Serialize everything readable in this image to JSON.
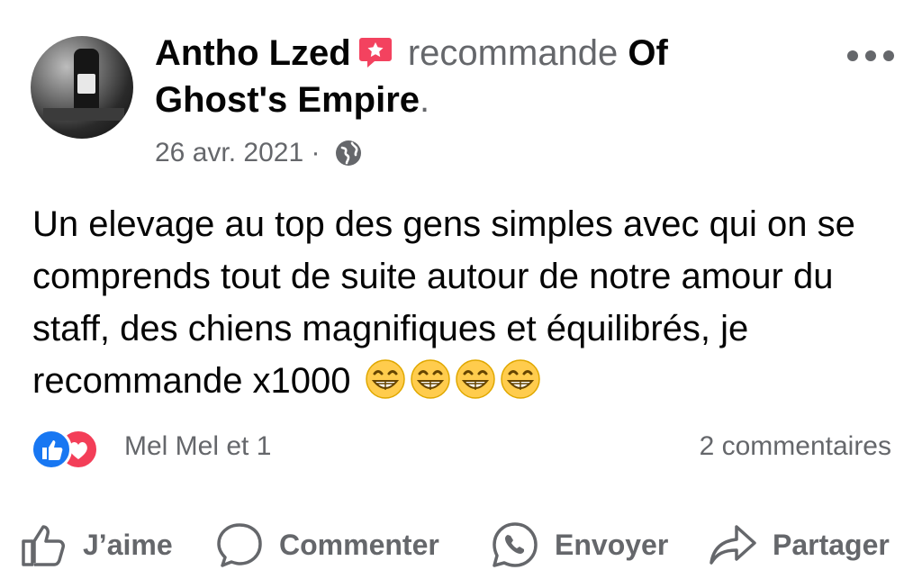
{
  "post": {
    "author": "Antho Lzed",
    "verb": "recommande",
    "page_name_line1": "Of",
    "page_name_line2": "Ghost's Empire",
    "period": ".",
    "date": "26 avr. 2021",
    "separator": "·",
    "privacy_icon": "globe-icon",
    "text": "Un elevage au top des gens simples avec qui on se comprends tout de suite autour de notre amour du staff, des chiens magnifiques et équilibrés,  je recommande x1000",
    "emojis": [
      "grinning-face",
      "grinning-face",
      "grinning-face",
      "grinning-face"
    ]
  },
  "reactions": {
    "icons": [
      "like",
      "love"
    ],
    "names": "Mel Mel et 1",
    "comments": "2 commentaires"
  },
  "actions": {
    "like": "J’aime",
    "comment": "Commenter",
    "send": "Envoyer",
    "share": "Partager"
  },
  "colors": {
    "text": "#050505",
    "muted": "#65676b",
    "like_blue": "#1877f2",
    "love_red": "#f33e58",
    "recommend_badge": "#f3425f"
  }
}
